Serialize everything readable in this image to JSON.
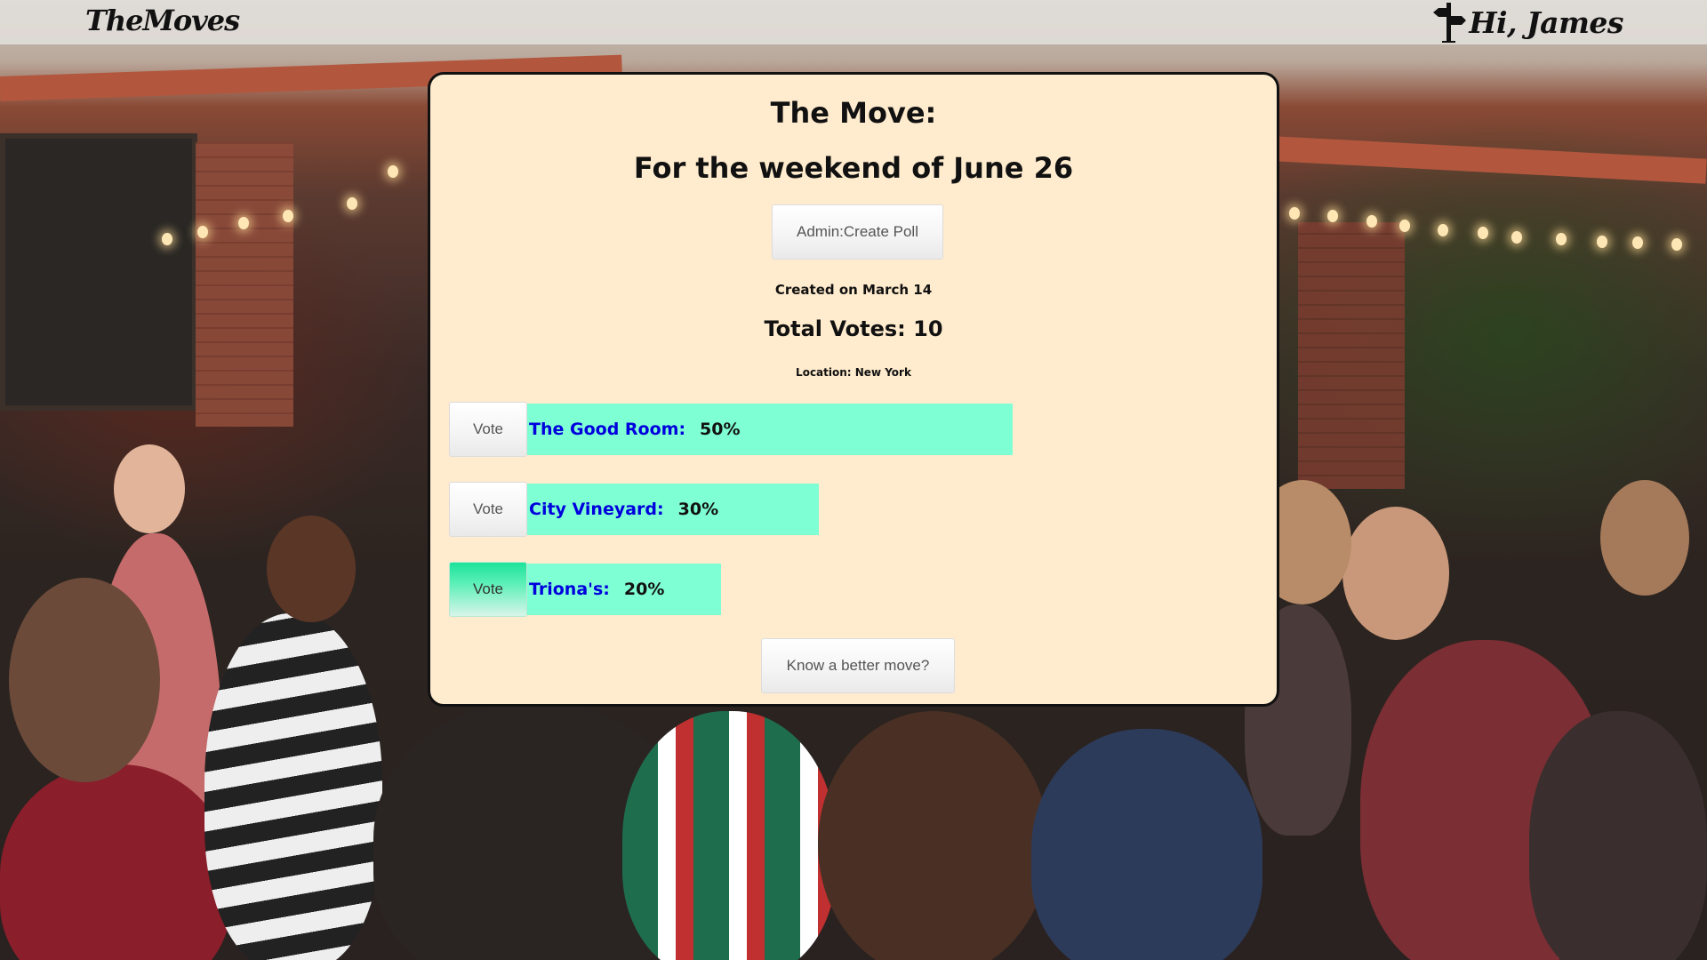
{
  "app": {
    "brand": "TheMoves",
    "greeting": "Hi, James"
  },
  "poll": {
    "title": "The Move:",
    "subtitle": "For the weekend of June 26",
    "admin_button": "Admin:Create Poll",
    "created": "Created on March 14",
    "total_votes": "Total Votes: 10",
    "location": "Location: New York",
    "vote_label": "Vote",
    "options": [
      {
        "name": "The Good Room:",
        "percent_label": "50%",
        "share": 0.5
      },
      {
        "name": "City Vineyard:",
        "percent_label": "30%",
        "share": 0.3
      },
      {
        "name": "Triona's:",
        "percent_label": "20%",
        "share": 0.2
      }
    ],
    "suggest_button": "Know a better move?"
  },
  "colors": {
    "card_bg": "#ffebcd",
    "bar": "#7fffd4",
    "option_text": "#0000dd",
    "active_vote": "#1de29a"
  },
  "icons": {
    "greeting_icon": "signpost-icon"
  }
}
